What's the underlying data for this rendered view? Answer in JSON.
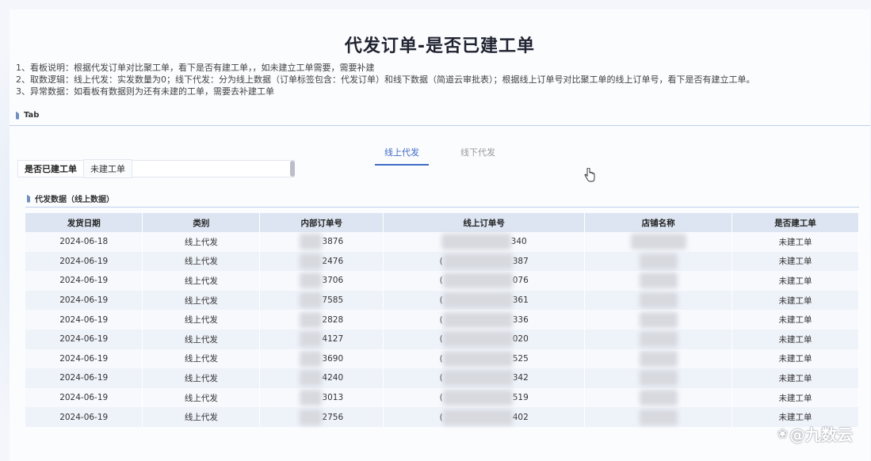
{
  "title": "代发订单-是否已建工单",
  "notes": [
    "1、看板说明：根据代发订单对比聚工单，看下是否有建工单，，如未建立工单需要，需要补建",
    "2、取数逻辑：线上代发：实发数量为0；线下代发：分为线上数据（订单标签包含：代发订单）和线下数据（简道云审批表）；根据线上订单号对比聚工单的线上订单号，看下是否有建立工单。",
    "3、异常数据：如看板有数据则为还有未建的工单，需要去补建工单"
  ],
  "tab_section_label": "Tab",
  "tabs": [
    {
      "label": "线上代发",
      "active": true
    },
    {
      "label": "线下代发",
      "active": false
    }
  ],
  "filter": {
    "label": "是否已建工单",
    "selected": "未建工单"
  },
  "data_section_label": "代发数据（线上数据）",
  "table": {
    "headers": [
      "发货日期",
      "类别",
      "内部订单号",
      "线上订单号",
      "店铺名称",
      "是否建工单"
    ],
    "rows": [
      {
        "date": "2024-06-18",
        "category": "线上代发",
        "inner_suffix": "3876",
        "online_prefix": "",
        "online_suffix": "340",
        "status": "未建工单"
      },
      {
        "date": "2024-06-19",
        "category": "线上代发",
        "inner_suffix": "2476",
        "online_prefix": "(",
        "online_suffix": "387",
        "status": "未建工单"
      },
      {
        "date": "2024-06-19",
        "category": "线上代发",
        "inner_suffix": "3706",
        "online_prefix": "(",
        "online_suffix": "076",
        "status": "未建工单"
      },
      {
        "date": "2024-06-19",
        "category": "线上代发",
        "inner_suffix": "7585",
        "online_prefix": "(",
        "online_suffix": "361",
        "status": "未建工单"
      },
      {
        "date": "2024-06-19",
        "category": "线上代发",
        "inner_suffix": "2828",
        "online_prefix": "(",
        "online_suffix": "336",
        "status": "未建工单"
      },
      {
        "date": "2024-06-19",
        "category": "线上代发",
        "inner_suffix": "4127",
        "online_prefix": "(",
        "online_suffix": "020",
        "status": "未建工单"
      },
      {
        "date": "2024-06-19",
        "category": "线上代发",
        "inner_suffix": "3690",
        "online_prefix": "(",
        "online_suffix": "525",
        "status": "未建工单"
      },
      {
        "date": "2024-06-19",
        "category": "线上代发",
        "inner_suffix": "4240",
        "online_prefix": "(",
        "online_suffix": "342",
        "status": "未建工单"
      },
      {
        "date": "2024-06-19",
        "category": "线上代发",
        "inner_suffix": "3013",
        "online_prefix": "(",
        "online_suffix": "519",
        "status": "未建工单"
      },
      {
        "date": "2024-06-19",
        "category": "线上代发",
        "inner_suffix": "2756",
        "online_prefix": "(",
        "online_suffix": "402",
        "status": "未建工单"
      }
    ]
  },
  "watermark": "@九数云",
  "colors": {
    "accent": "#3f6bc4",
    "header_bg": "#dde5f2",
    "section_mark": "#6f8fbf"
  }
}
